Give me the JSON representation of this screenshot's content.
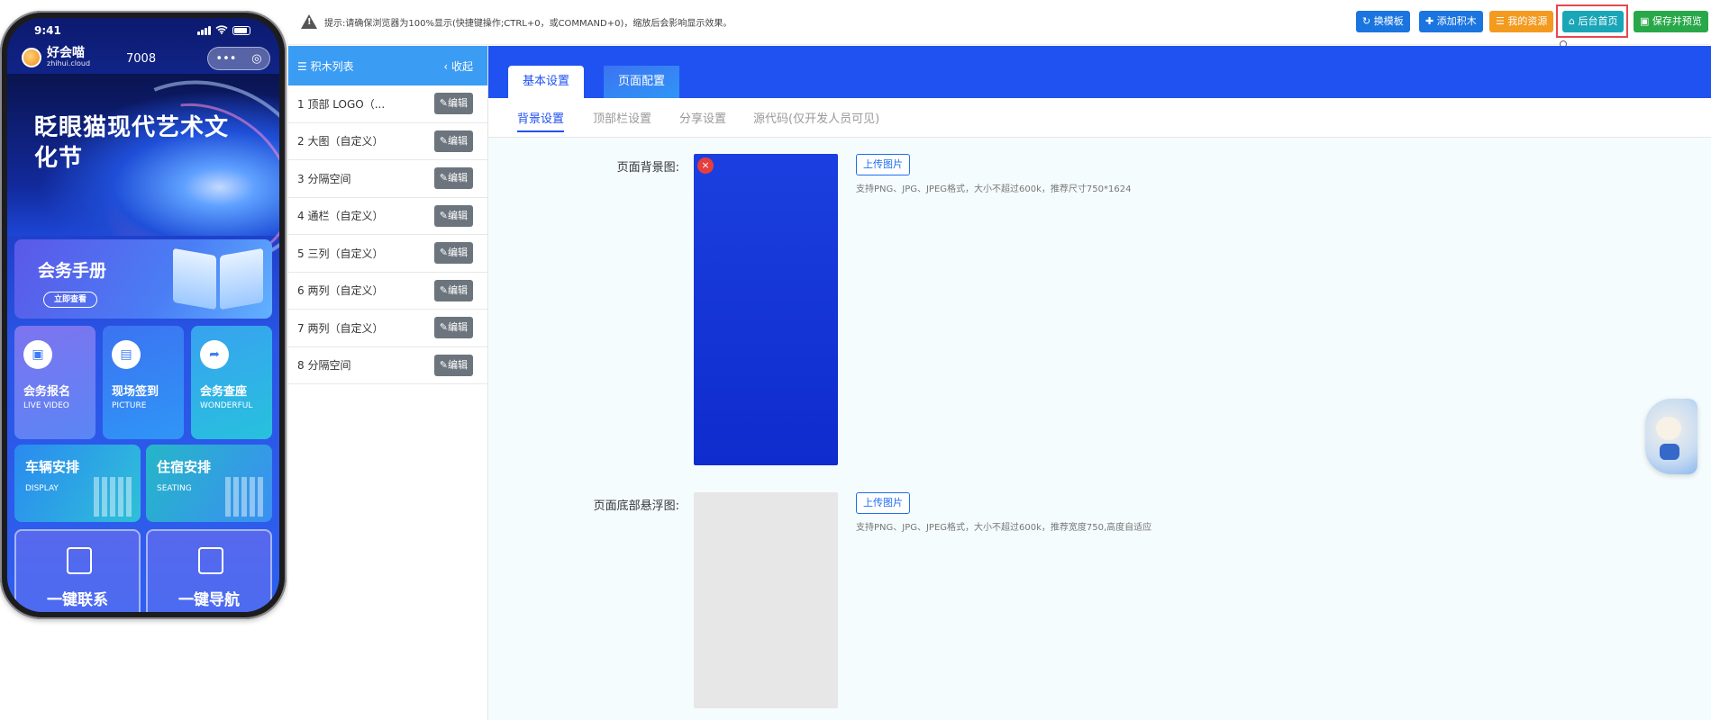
{
  "phone": {
    "time": "9:41",
    "brand_name": "好会喵",
    "brand_domain": "zhihui.cloud",
    "room_number": "7008",
    "capsule_more": "•••",
    "capsule_close": "◎",
    "hero_title": "眨眼猫现代艺术文化节",
    "manual": {
      "title": "会务手册",
      "button": "立即查看"
    },
    "tiles": [
      {
        "title": "会务报名",
        "subtitle": "LIVE VIDEO",
        "icon": "camera-icon"
      },
      {
        "title": "现场签到",
        "subtitle": "PICTURE",
        "icon": "picture-icon"
      },
      {
        "title": "会务查座",
        "subtitle": "WONDERFUL",
        "icon": "share-icon"
      }
    ],
    "wide_tiles": [
      {
        "title": "车辆安排",
        "subtitle": "DISPLAY"
      },
      {
        "title": "住宿安排",
        "subtitle": "SEATING"
      }
    ],
    "big_tiles": [
      {
        "title": "一键联系"
      },
      {
        "title": "一键导航"
      }
    ]
  },
  "toolbar": {
    "tip": "提示:请确保浏览器为100%显示(快捷键操作;CTRL+0，或COMMAND+0)，缩放后会影响显示效果。",
    "swap_template": "换模板",
    "add_block": "添加积木",
    "my_resources": "我的资源",
    "admin_home": "后台首页",
    "save_preview": "保存并预览"
  },
  "sidebar": {
    "title": "积木列表",
    "collapse": "收起",
    "edit_label": "编辑",
    "items": [
      {
        "label": "1 顶部 LOGO（..."
      },
      {
        "label": "2 大图（自定义）"
      },
      {
        "label": "3 分隔空间"
      },
      {
        "label": "4 通栏（自定义）"
      },
      {
        "label": "5 三列（自定义）"
      },
      {
        "label": "6 两列（自定义）"
      },
      {
        "label": "7 两列（自定义）"
      },
      {
        "label": "8 分隔空间"
      }
    ]
  },
  "main": {
    "tabs": [
      {
        "label": "基本设置"
      },
      {
        "label": "页面配置"
      }
    ],
    "subtabs": [
      {
        "label": "背景设置"
      },
      {
        "label": "顶部栏设置"
      },
      {
        "label": "分享设置"
      },
      {
        "label": "源代码(仅开发人员可见)"
      }
    ],
    "background": {
      "label": "页面背景图:",
      "upload": "上传图片",
      "hint": "支持PNG、JPG、JPEG格式，大小不超过600k，推荐尺寸750*1624",
      "delete": "×"
    },
    "footer_float": {
      "label": "页面底部悬浮图:",
      "upload": "上传图片",
      "hint": "支持PNG、JPG、JPEG格式，大小不超过600k，推荐宽度750,高度自适应"
    }
  },
  "colors": {
    "primary": "#1f52f0",
    "sidebar_header": "#3b9cf4",
    "btn_blue": "#1b75e0",
    "btn_orange": "#f39a1f",
    "btn_teal": "#1aa6b7",
    "btn_green": "#29a84a",
    "highlight_red": "#e5484d"
  }
}
